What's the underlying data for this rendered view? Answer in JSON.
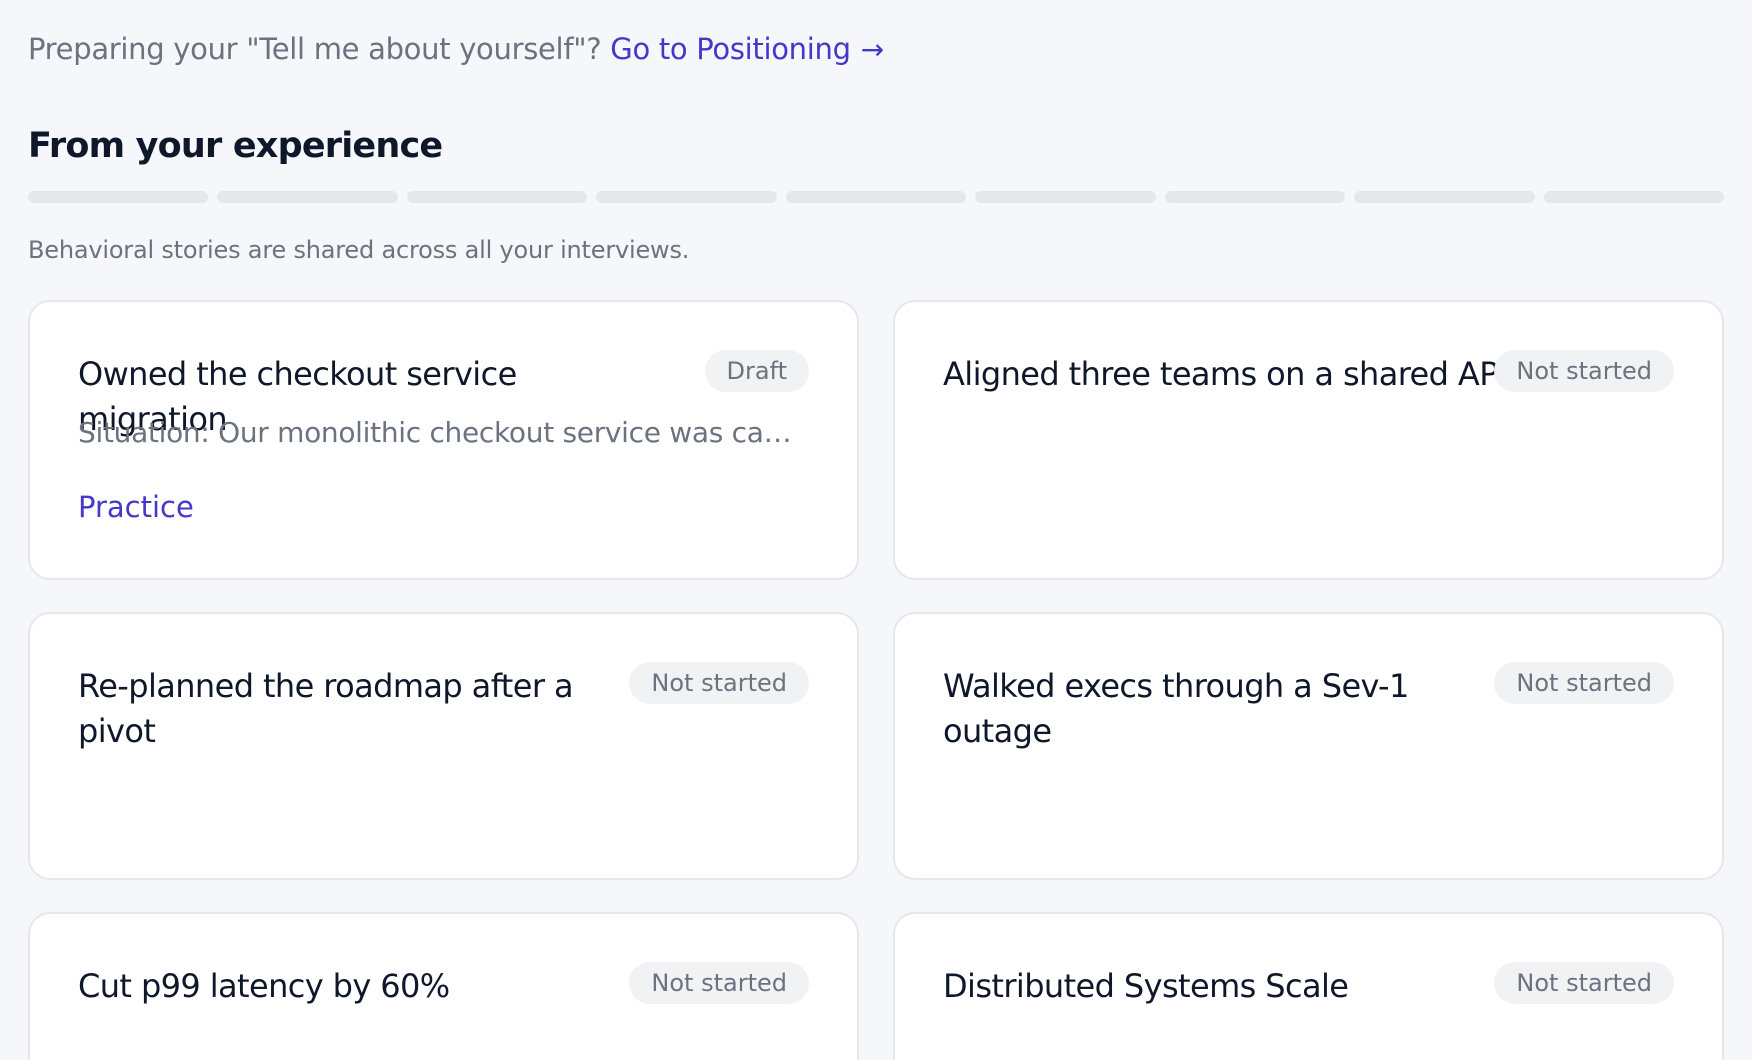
{
  "banner": {
    "prompt": "Preparing your \"Tell me about yourself\"?",
    "link_label": "Go to Positioning",
    "link_icon": "arrow-right-icon"
  },
  "section": {
    "title": "From your experience",
    "subtitle": "Behavioral stories are shared across all your interviews.",
    "progress_segments": 9,
    "progress_completed": 0
  },
  "cards": [
    {
      "title": "Owned the checkout service migration",
      "status": "Draft",
      "excerpt": "Situation: Our monolithic checkout service was causing frequent outages during peak traffic",
      "action_label": "Practice"
    },
    {
      "title": "Aligned three teams on a shared API",
      "status": "Not started"
    },
    {
      "title": "Re-planned the roadmap after a pivot",
      "status": "Not started"
    },
    {
      "title": "Walked execs through a Sev-1 outage",
      "status": "Not started"
    },
    {
      "title": "Cut p99 latency by 60%",
      "status": "Not started"
    },
    {
      "title": "Distributed Systems Scale",
      "status": "Not started"
    }
  ],
  "colors": {
    "accent": "#4338ca",
    "background": "#f5f7fa",
    "muted_text": "#6b7280",
    "badge_bg": "#f1f2f4"
  }
}
